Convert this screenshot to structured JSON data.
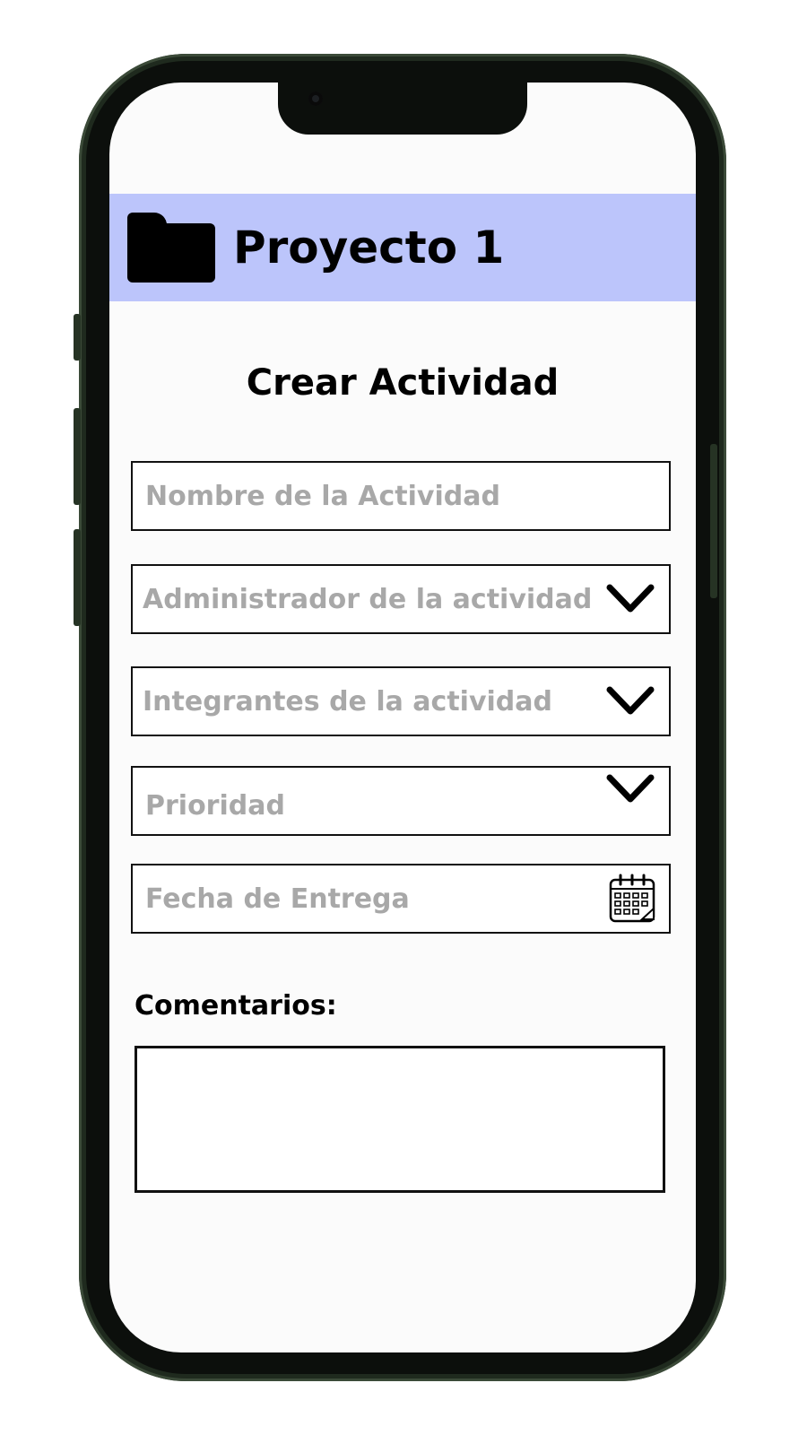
{
  "header": {
    "project_title": "Proyecto 1",
    "icon": "folder-icon",
    "background_color": "#bcc5fb"
  },
  "form": {
    "title": "Crear Actividad",
    "fields": {
      "activity_name": {
        "placeholder": "Nombre de la Actividad"
      },
      "activity_admin": {
        "placeholder": "Administrador de la actividad",
        "icon": "chevron-down-icon"
      },
      "activity_members": {
        "placeholder": "Integrantes de la actividad",
        "icon": "chevron-down-icon"
      },
      "priority": {
        "placeholder": "Prioridad",
        "icon": "chevron-down-icon"
      },
      "due_date": {
        "placeholder": "Fecha de Entrega",
        "icon": "calendar-icon"
      }
    },
    "comments": {
      "label": "Comentarios:",
      "value": ""
    }
  },
  "colors": {
    "placeholder_text": "#a8a8a8",
    "field_border": "#111111",
    "screen_background": "#fbfbfb"
  }
}
